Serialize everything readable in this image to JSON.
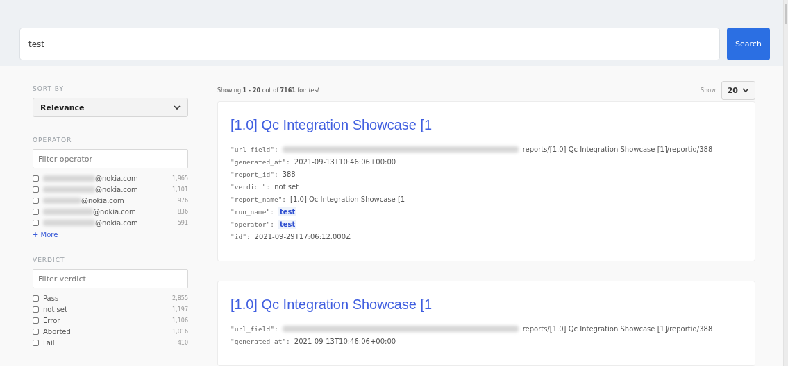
{
  "search": {
    "value": "test",
    "button": "Search"
  },
  "sidebar": {
    "sort": {
      "label": "SORT BY",
      "value": "Relevance"
    },
    "facets": [
      {
        "title": "OPERATOR",
        "placeholder": "Filter operator",
        "redacted": true,
        "items": [
          {
            "label": "@nokia.com",
            "count": "1,965",
            "checked": false
          },
          {
            "label": "@nokia.com",
            "count": "1,101",
            "checked": false
          },
          {
            "label": "@nokia.com",
            "count": "976",
            "checked": false
          },
          {
            "label": "@nokia.com",
            "count": "836",
            "checked": false
          },
          {
            "label": "@nokia.com",
            "count": "591",
            "checked": false
          }
        ],
        "more": "+ More"
      },
      {
        "title": "VERDICT",
        "placeholder": "Filter verdict",
        "redacted": false,
        "items": [
          {
            "label": "Pass",
            "count": "2,855",
            "checked": false
          },
          {
            "label": "not set",
            "count": "1,197",
            "checked": false
          },
          {
            "label": "Error",
            "count": "1,106",
            "checked": false
          },
          {
            "label": "Aborted",
            "count": "1,016",
            "checked": false
          },
          {
            "label": "Fail",
            "count": "410",
            "checked": false
          }
        ]
      }
    ]
  },
  "summary": "Showing **1 - 20** out of **7161** for: *test*",
  "show": {
    "label": "Show",
    "value": "20"
  },
  "results": [
    {
      "title": "[1.0] Qc Integration Showcase [1",
      "fields": [
        {
          "key": "\"url_field\":",
          "value": "reports/[1.0] Qc Integration Showcase [1]/reportid/388",
          "redacted": true,
          "highlight": false
        },
        {
          "key": "\"generated_at\":",
          "value": "2021-09-13T10:46:06+00:00",
          "redacted": false,
          "highlight": false
        },
        {
          "key": "\"report_id\":",
          "value": "388",
          "redacted": false,
          "highlight": false
        },
        {
          "key": "\"verdict\":",
          "value": "not set",
          "redacted": false,
          "highlight": false
        },
        {
          "key": "\"report_name\":",
          "value": "[1.0] Qc Integration Showcase [1",
          "redacted": false,
          "highlight": false
        },
        {
          "key": "\"run_name\":",
          "value": "test",
          "redacted": false,
          "highlight": true
        },
        {
          "key": "\"operator\":",
          "value": "test",
          "redacted": false,
          "highlight": true
        },
        {
          "key": "\"id\":",
          "value": "2021-09-29T17:06:12.000Z",
          "redacted": false,
          "highlight": false
        }
      ]
    },
    {
      "title": "[1.0] Qc Integration Showcase [1",
      "fields": [
        {
          "key": "\"url_field\":",
          "value": "reports/[1.0] Qc Integration Showcase [1]/reportid/388",
          "redacted": true,
          "highlight": false
        },
        {
          "key": "\"generated_at\":",
          "value": "2021-09-13T10:46:06+00:00",
          "redacted": false,
          "highlight": false
        }
      ]
    }
  ]
}
